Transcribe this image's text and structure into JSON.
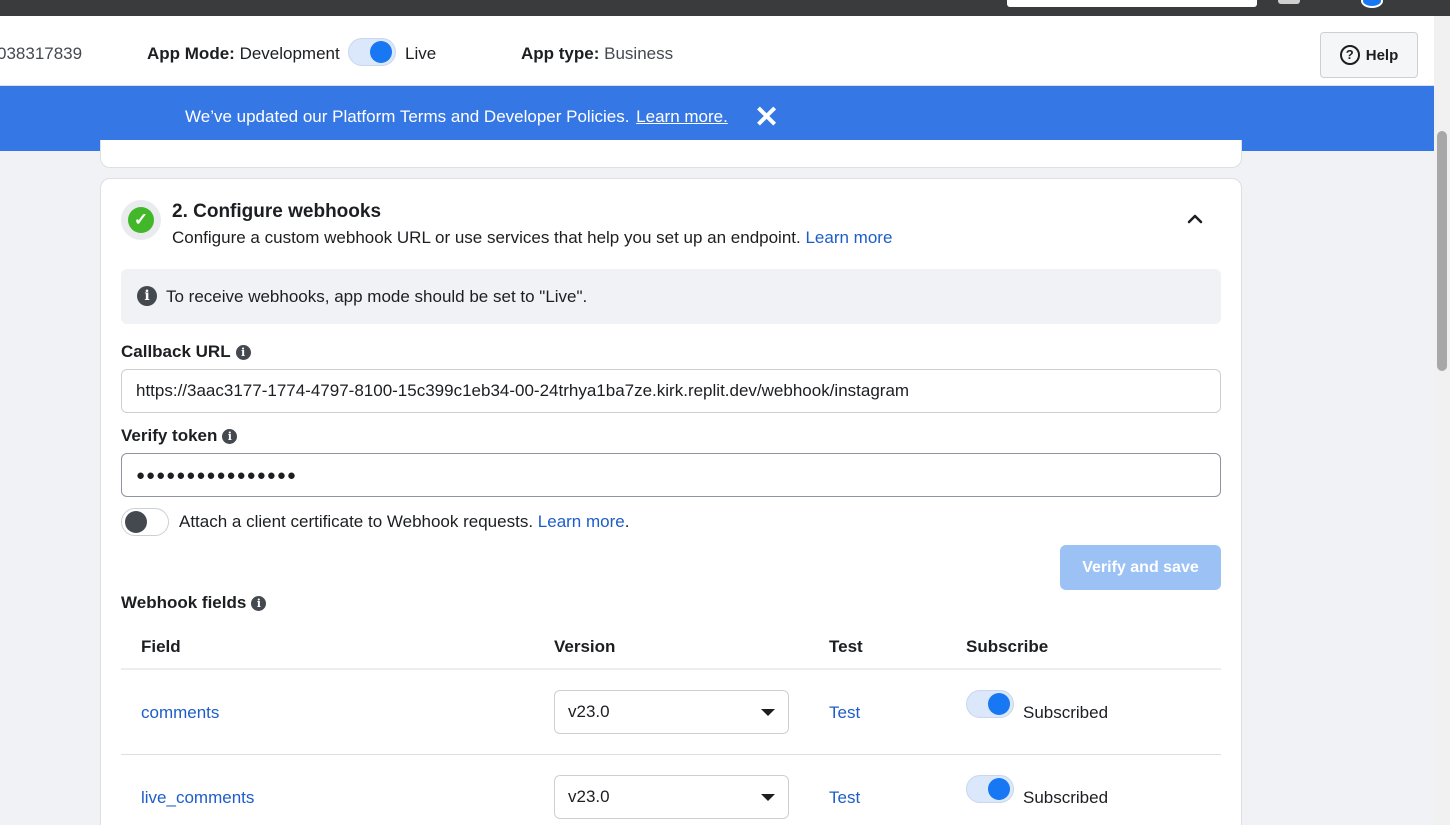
{
  "app_bar": {
    "app_id": "038317839",
    "mode_label": "App Mode:",
    "mode_value": "Development",
    "live_label": "Live",
    "type_label": "App type:",
    "type_value": "Business",
    "help_label": "Help"
  },
  "banner": {
    "message": "We’ve updated our Platform Terms and Developer Policies.",
    "link": "Learn more.",
    "close_glyph": "✕"
  },
  "section": {
    "title": "2. Configure webhooks",
    "subtitle": "Configure a custom webhook URL or use services that help you set up an endpoint.",
    "subtitle_link": "Learn more",
    "notice": "To receive webhooks, app mode should be set to \"Live\".",
    "callback_label": "Callback URL",
    "callback_value": "https://3aac3177-1774-4797-8100-15c399c1eb34-00-24trhya1ba7ze.kirk.replit.dev/webhook/instagram",
    "verify_label": "Verify token",
    "verify_value": "●●●●●●●●●●●●●●●●",
    "cert_text": "Attach a client certificate to Webhook requests.",
    "cert_link": "Learn more",
    "verify_button": "Verify and save",
    "fields_label": "Webhook fields"
  },
  "table": {
    "headers": [
      "Field",
      "Version",
      "Test",
      "Subscribe"
    ],
    "rows": [
      {
        "field": "comments",
        "version": "v23.0",
        "test": "Test",
        "status": "Subscribed",
        "subscribed": true
      },
      {
        "field": "live_comments",
        "version": "v23.0",
        "test": "Test",
        "status": "Subscribed",
        "subscribed": true
      }
    ]
  },
  "colors": {
    "banner": "#3578e5",
    "link": "#1d5dc9",
    "toggle_on": "#1877f2",
    "success": "#42b72a"
  },
  "icons": [
    "help-icon",
    "close-icon",
    "check-icon",
    "chevron-up-icon",
    "info-icon",
    "caret-down-icon"
  ]
}
